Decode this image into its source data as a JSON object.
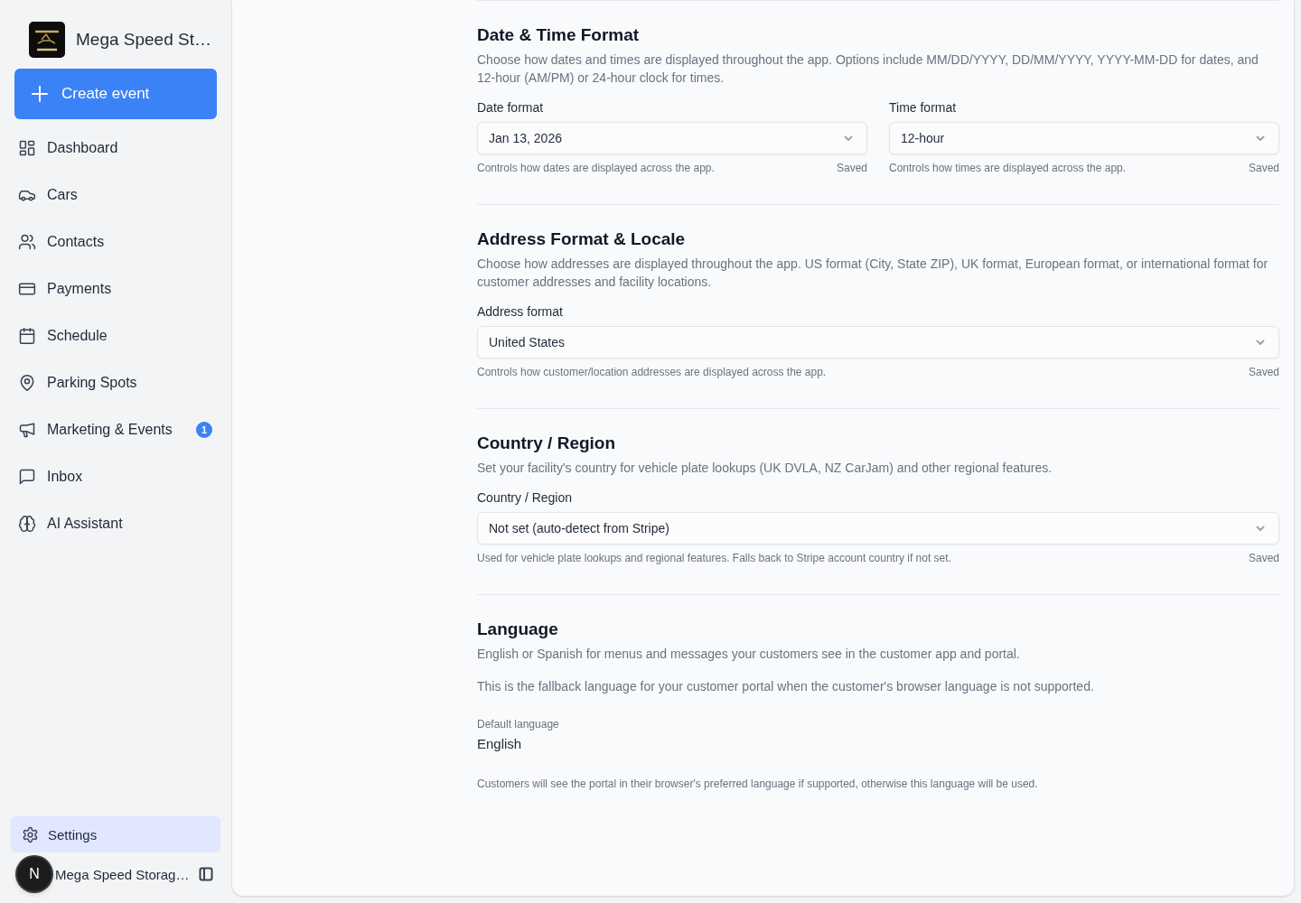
{
  "sidebar": {
    "brand": {
      "name": "Mega Speed St…"
    },
    "create_button": {
      "label": "Create event"
    },
    "nav_items": [
      {
        "label": "Dashboard",
        "selected": false
      },
      {
        "label": "Cars",
        "selected": false
      },
      {
        "label": "Contacts",
        "selected": false
      },
      {
        "label": "Payments",
        "selected": false
      },
      {
        "label": "Schedule",
        "selected": false
      },
      {
        "label": "Parking Spots",
        "selected": false
      },
      {
        "label": "Marketing & Events",
        "selected": false,
        "badge": "1"
      },
      {
        "label": "Inbox",
        "selected": false
      },
      {
        "label": "AI Assistant",
        "selected": false
      }
    ],
    "footer_items": [
      {
        "label": "Settings",
        "selected": true
      }
    ],
    "account": {
      "avatar_initial": "N",
      "name": "Mega Speed Storag…"
    }
  },
  "sections": [
    {
      "kind": "selects",
      "title": "Date & Time Format",
      "description": "Choose how dates and times are displayed throughout the app. Options include MM/DD/YYYY, DD/MM/YYYY, YYYY-MM-DD for dates, and 12-hour (AM/PM) or 24-hour clock for times.",
      "fields": [
        {
          "label": "Date format",
          "value": "Jan 13, 2026",
          "hint": "Controls how dates are displayed across the app.",
          "status": "Saved"
        },
        {
          "label": "Time format",
          "value": "12-hour",
          "hint": "Controls how times are displayed across the app.",
          "status": "Saved"
        }
      ]
    },
    {
      "kind": "selects",
      "title": "Address Format & Locale",
      "description": "Choose how addresses are displayed throughout the app. US format (City, State ZIP), UK format, European format, or international format for customer addresses and facility locations.",
      "fields": [
        {
          "label": "Address format",
          "value": "United States",
          "hint": "Controls how customer/location addresses are displayed across the app.",
          "status": "Saved"
        }
      ]
    },
    {
      "kind": "selects",
      "title": "Country / Region",
      "description": "Set your facility's country for vehicle plate lookups (UK DVLA, NZ CarJam) and other regional features.",
      "fields": [
        {
          "label": "Country / Region",
          "value": "Not set (auto-detect from Stripe)",
          "hint": "Used for vehicle plate lookups and regional features. Falls back to Stripe account country if not set.",
          "status": "Saved"
        }
      ]
    },
    {
      "kind": "display",
      "title": "Language",
      "paragraphs": [
        "English or Spanish for menus and messages your customers see in the customer app and portal.",
        "This is the fallback language for your customer portal when the customer's browser language is not supported."
      ],
      "setting": {
        "label": "Default language",
        "value": "English"
      },
      "note": "Customers will see the portal in their browser's preferred language if supported, otherwise this language will be used."
    }
  ]
}
